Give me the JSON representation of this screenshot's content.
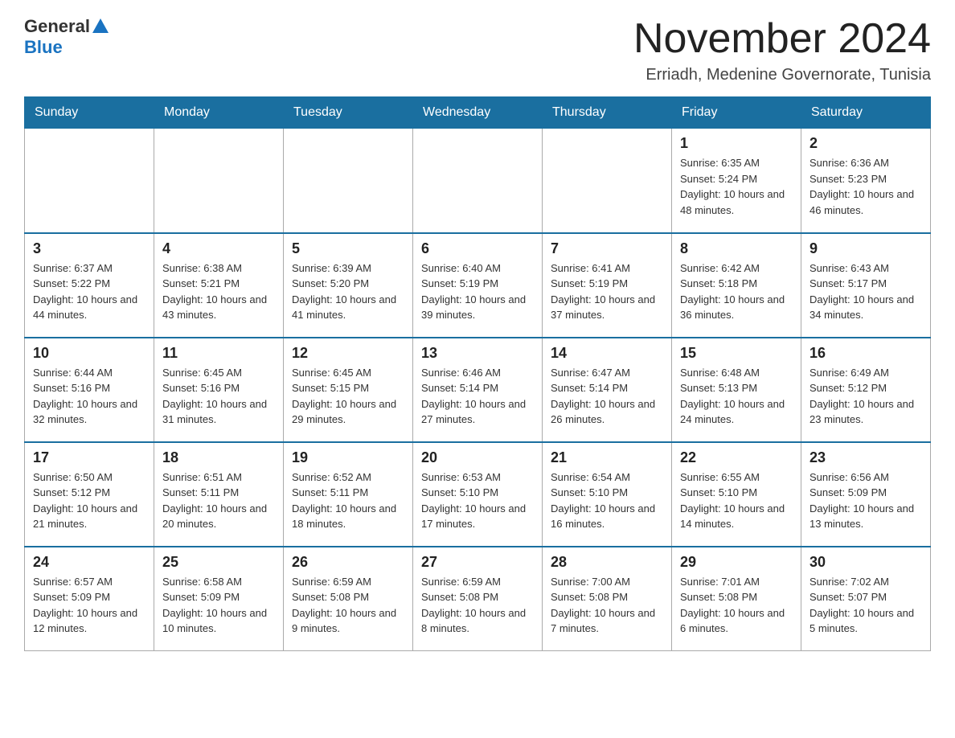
{
  "logo": {
    "general": "General",
    "blue": "Blue"
  },
  "header": {
    "month": "November 2024",
    "location": "Erriadh, Medenine Governorate, Tunisia"
  },
  "days_of_week": [
    "Sunday",
    "Monday",
    "Tuesday",
    "Wednesday",
    "Thursday",
    "Friday",
    "Saturday"
  ],
  "weeks": [
    {
      "days": [
        {
          "num": "",
          "info": ""
        },
        {
          "num": "",
          "info": ""
        },
        {
          "num": "",
          "info": ""
        },
        {
          "num": "",
          "info": ""
        },
        {
          "num": "",
          "info": ""
        },
        {
          "num": "1",
          "info": "Sunrise: 6:35 AM\nSunset: 5:24 PM\nDaylight: 10 hours and 48 minutes."
        },
        {
          "num": "2",
          "info": "Sunrise: 6:36 AM\nSunset: 5:23 PM\nDaylight: 10 hours and 46 minutes."
        }
      ]
    },
    {
      "days": [
        {
          "num": "3",
          "info": "Sunrise: 6:37 AM\nSunset: 5:22 PM\nDaylight: 10 hours and 44 minutes."
        },
        {
          "num": "4",
          "info": "Sunrise: 6:38 AM\nSunset: 5:21 PM\nDaylight: 10 hours and 43 minutes."
        },
        {
          "num": "5",
          "info": "Sunrise: 6:39 AM\nSunset: 5:20 PM\nDaylight: 10 hours and 41 minutes."
        },
        {
          "num": "6",
          "info": "Sunrise: 6:40 AM\nSunset: 5:19 PM\nDaylight: 10 hours and 39 minutes."
        },
        {
          "num": "7",
          "info": "Sunrise: 6:41 AM\nSunset: 5:19 PM\nDaylight: 10 hours and 37 minutes."
        },
        {
          "num": "8",
          "info": "Sunrise: 6:42 AM\nSunset: 5:18 PM\nDaylight: 10 hours and 36 minutes."
        },
        {
          "num": "9",
          "info": "Sunrise: 6:43 AM\nSunset: 5:17 PM\nDaylight: 10 hours and 34 minutes."
        }
      ]
    },
    {
      "days": [
        {
          "num": "10",
          "info": "Sunrise: 6:44 AM\nSunset: 5:16 PM\nDaylight: 10 hours and 32 minutes."
        },
        {
          "num": "11",
          "info": "Sunrise: 6:45 AM\nSunset: 5:16 PM\nDaylight: 10 hours and 31 minutes."
        },
        {
          "num": "12",
          "info": "Sunrise: 6:45 AM\nSunset: 5:15 PM\nDaylight: 10 hours and 29 minutes."
        },
        {
          "num": "13",
          "info": "Sunrise: 6:46 AM\nSunset: 5:14 PM\nDaylight: 10 hours and 27 minutes."
        },
        {
          "num": "14",
          "info": "Sunrise: 6:47 AM\nSunset: 5:14 PM\nDaylight: 10 hours and 26 minutes."
        },
        {
          "num": "15",
          "info": "Sunrise: 6:48 AM\nSunset: 5:13 PM\nDaylight: 10 hours and 24 minutes."
        },
        {
          "num": "16",
          "info": "Sunrise: 6:49 AM\nSunset: 5:12 PM\nDaylight: 10 hours and 23 minutes."
        }
      ]
    },
    {
      "days": [
        {
          "num": "17",
          "info": "Sunrise: 6:50 AM\nSunset: 5:12 PM\nDaylight: 10 hours and 21 minutes."
        },
        {
          "num": "18",
          "info": "Sunrise: 6:51 AM\nSunset: 5:11 PM\nDaylight: 10 hours and 20 minutes."
        },
        {
          "num": "19",
          "info": "Sunrise: 6:52 AM\nSunset: 5:11 PM\nDaylight: 10 hours and 18 minutes."
        },
        {
          "num": "20",
          "info": "Sunrise: 6:53 AM\nSunset: 5:10 PM\nDaylight: 10 hours and 17 minutes."
        },
        {
          "num": "21",
          "info": "Sunrise: 6:54 AM\nSunset: 5:10 PM\nDaylight: 10 hours and 16 minutes."
        },
        {
          "num": "22",
          "info": "Sunrise: 6:55 AM\nSunset: 5:10 PM\nDaylight: 10 hours and 14 minutes."
        },
        {
          "num": "23",
          "info": "Sunrise: 6:56 AM\nSunset: 5:09 PM\nDaylight: 10 hours and 13 minutes."
        }
      ]
    },
    {
      "days": [
        {
          "num": "24",
          "info": "Sunrise: 6:57 AM\nSunset: 5:09 PM\nDaylight: 10 hours and 12 minutes."
        },
        {
          "num": "25",
          "info": "Sunrise: 6:58 AM\nSunset: 5:09 PM\nDaylight: 10 hours and 10 minutes."
        },
        {
          "num": "26",
          "info": "Sunrise: 6:59 AM\nSunset: 5:08 PM\nDaylight: 10 hours and 9 minutes."
        },
        {
          "num": "27",
          "info": "Sunrise: 6:59 AM\nSunset: 5:08 PM\nDaylight: 10 hours and 8 minutes."
        },
        {
          "num": "28",
          "info": "Sunrise: 7:00 AM\nSunset: 5:08 PM\nDaylight: 10 hours and 7 minutes."
        },
        {
          "num": "29",
          "info": "Sunrise: 7:01 AM\nSunset: 5:08 PM\nDaylight: 10 hours and 6 minutes."
        },
        {
          "num": "30",
          "info": "Sunrise: 7:02 AM\nSunset: 5:07 PM\nDaylight: 10 hours and 5 minutes."
        }
      ]
    }
  ]
}
